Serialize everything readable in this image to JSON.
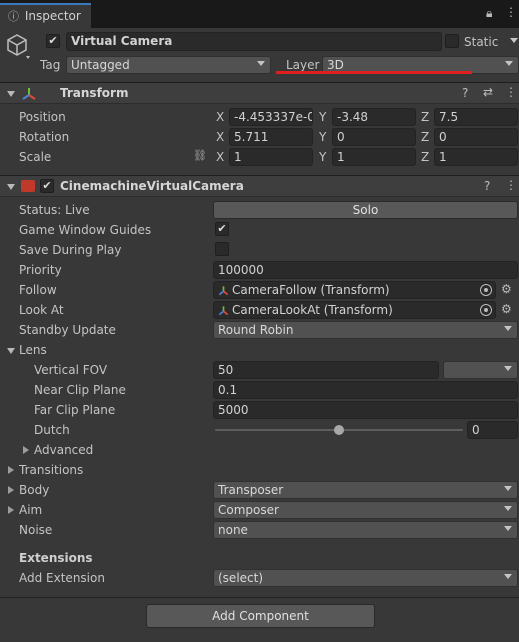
{
  "tab": {
    "title": "Inspector"
  },
  "object": {
    "name": "Virtual Camera",
    "static_label": "Static",
    "tag_label": "Tag",
    "tag_value": "Untagged",
    "layer_label": "Layer",
    "layer_value": "3D"
  },
  "transform": {
    "title": "Transform",
    "position": {
      "label": "Position",
      "x": "-4.453337e-0",
      "y": "-3.48",
      "z": "7.5"
    },
    "rotation": {
      "label": "Rotation",
      "x": "5.711",
      "y": "0",
      "z": "0"
    },
    "scale": {
      "label": "Scale",
      "x": "1",
      "y": "1",
      "z": "1"
    },
    "axis_x": "X",
    "axis_y": "Y",
    "axis_z": "Z"
  },
  "vcam": {
    "title": "CinemachineVirtualCamera",
    "status_label": "Status: Live",
    "solo_label": "Solo",
    "guides_label": "Game Window Guides",
    "save_label": "Save During Play",
    "priority_label": "Priority",
    "priority_value": "100000",
    "follow_label": "Follow",
    "follow_value": "CameraFollow (Transform)",
    "lookat_label": "Look At",
    "lookat_value": "CameraLookAt (Transform)",
    "standby_label": "Standby Update",
    "standby_value": "Round Robin",
    "lens_label": "Lens",
    "fov_label": "Vertical FOV",
    "fov_value": "50",
    "near_label": "Near Clip Plane",
    "near_value": "0.1",
    "far_label": "Far Clip Plane",
    "far_value": "5000",
    "dutch_label": "Dutch",
    "dutch_value": "0",
    "dutch_slider_fraction": 0.5,
    "advanced_label": "Advanced",
    "transitions_label": "Transitions",
    "body_label": "Body",
    "body_value": "Transposer",
    "aim_label": "Aim",
    "aim_value": "Composer",
    "noise_label": "Noise",
    "noise_value": "none",
    "extensions_label": "Extensions",
    "add_ext_label": "Add Extension",
    "add_ext_value": "(select)"
  },
  "add_component_label": "Add Component",
  "colors": {
    "accent": "#3a79bb",
    "underline": "#e02020",
    "background": "#383838"
  }
}
